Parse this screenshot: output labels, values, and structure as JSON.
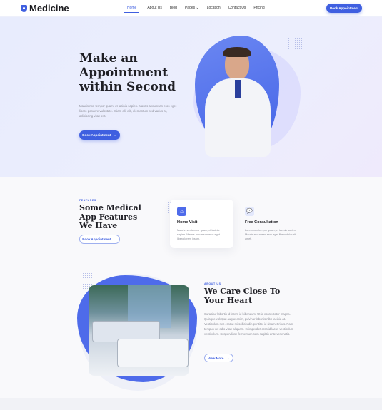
{
  "nav": {
    "brand": "Medicine",
    "items": [
      "Home",
      "About Us",
      "Blog",
      "Pages",
      "Location",
      "Contact Us",
      "Pricing"
    ],
    "active": "Home",
    "cta": "Book Appointment"
  },
  "hero": {
    "title_lines": [
      "Make an",
      "Appointment",
      "within Second"
    ],
    "text": "Mauris non tempor quam, et lacinia sapien. Mauris accumsan eros eget libero posuere vulputate. Etiam elit elit, elementum sed varius at, adipiscing vitae est.",
    "cta": "Book Appointment"
  },
  "features": {
    "label": "FEATURES",
    "title_lines": [
      "Some Medical",
      "App Features",
      "We Have"
    ],
    "cta": "Book Appointment",
    "cards": [
      {
        "icon": "home-icon",
        "title": "Home Visit",
        "text": "Mauris non tempor quam, et lacinia sapien. Mauris accumsan eros eget libero lorem ipsum."
      },
      {
        "icon": "chat-icon",
        "title": "Free Consultation",
        "text": "Lorem non tempor quam, et lacinia sapien. Mauris accumsan eros eget libero dolor sit amet."
      }
    ]
  },
  "about": {
    "label": "ABOUT US",
    "title_lines": [
      "We Care Close To",
      "Your Heart"
    ],
    "text": "Curabitur lobortis id lorem id bibendum. Ut id consectetur magna. Quisque volutpat augue enim, pulvinar lobortis nibh lacinia at. Vestibulum nec erat ut mi sollicitudin porttitor id sit amet risus. Nam tempus vel odio vitae aliquam. In imperdiet eros id lacus vestibulum vestibulum. Suspendisse fermentum sem sagittis ante venenatis.",
    "cta": "View More"
  },
  "colors": {
    "accent": "#3f5fe0",
    "hero_bg": "#e9edfd"
  }
}
